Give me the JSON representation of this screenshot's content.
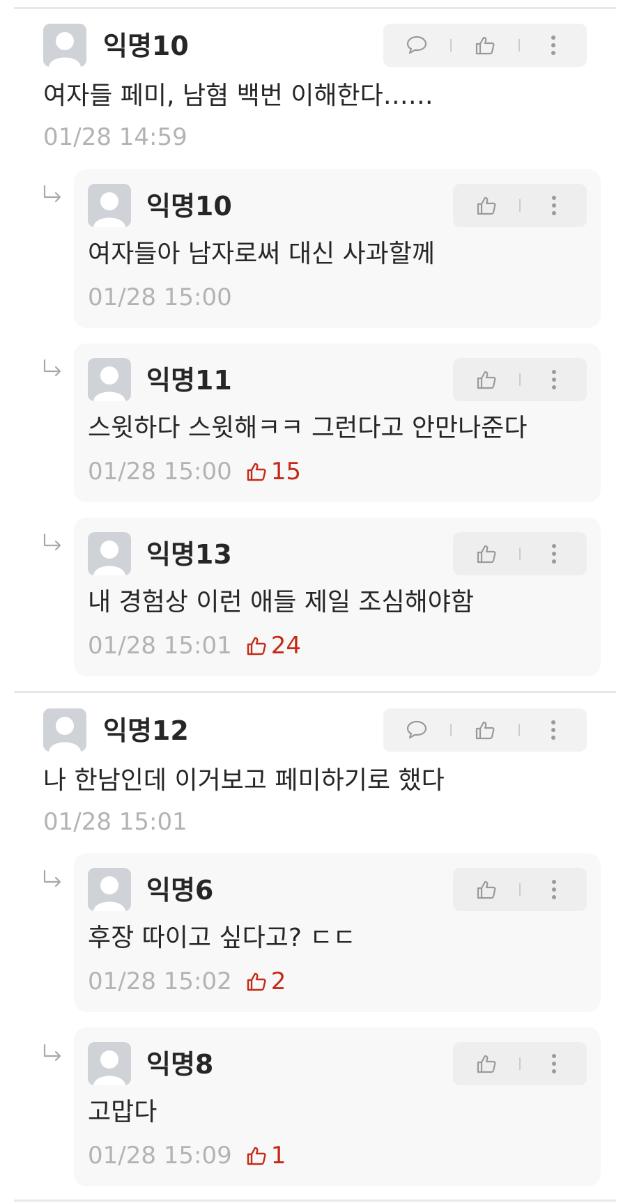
{
  "colors": {
    "like_accent": "#c62917",
    "muted_text": "#b3b3b3",
    "primary_text": "#262626",
    "reply_background": "#f8f8f8"
  },
  "icons": {
    "comment": "speech-bubble-icon",
    "like": "thumbs-up-icon",
    "more": "vertical-dots-icon",
    "reply": "reply-arrow-icon",
    "avatar": "anonymous-avatar-icon"
  },
  "threads": [
    {
      "comment": {
        "author": "익명10",
        "text": "여자들 페미, 남혐 백번 이해한다……",
        "time": "01/28 14:59"
      },
      "replies": [
        {
          "author": "익명10",
          "text": "여자들아 남자로써 대신 사과할께",
          "time": "01/28 15:00",
          "likes": ""
        },
        {
          "author": "익명11",
          "text": "스윗하다 스윗해ㅋㅋ 그런다고 안만나준다",
          "time": "01/28 15:00",
          "likes": "15"
        },
        {
          "author": "익명13",
          "text": "내 경험상 이런 애들 제일 조심해야함",
          "time": "01/28 15:01",
          "likes": "24"
        }
      ]
    },
    {
      "comment": {
        "author": "익명12",
        "text": "나 한남인데 이거보고 페미하기로 했다",
        "time": "01/28 15:01"
      },
      "replies": [
        {
          "author": "익명6",
          "text": "후장 따이고 싶다고?  ㄷㄷ",
          "time": "01/28 15:02",
          "likes": "2"
        },
        {
          "author": "익명8",
          "text": "고맙다",
          "time": "01/28 15:09",
          "likes": "1"
        }
      ]
    }
  ]
}
